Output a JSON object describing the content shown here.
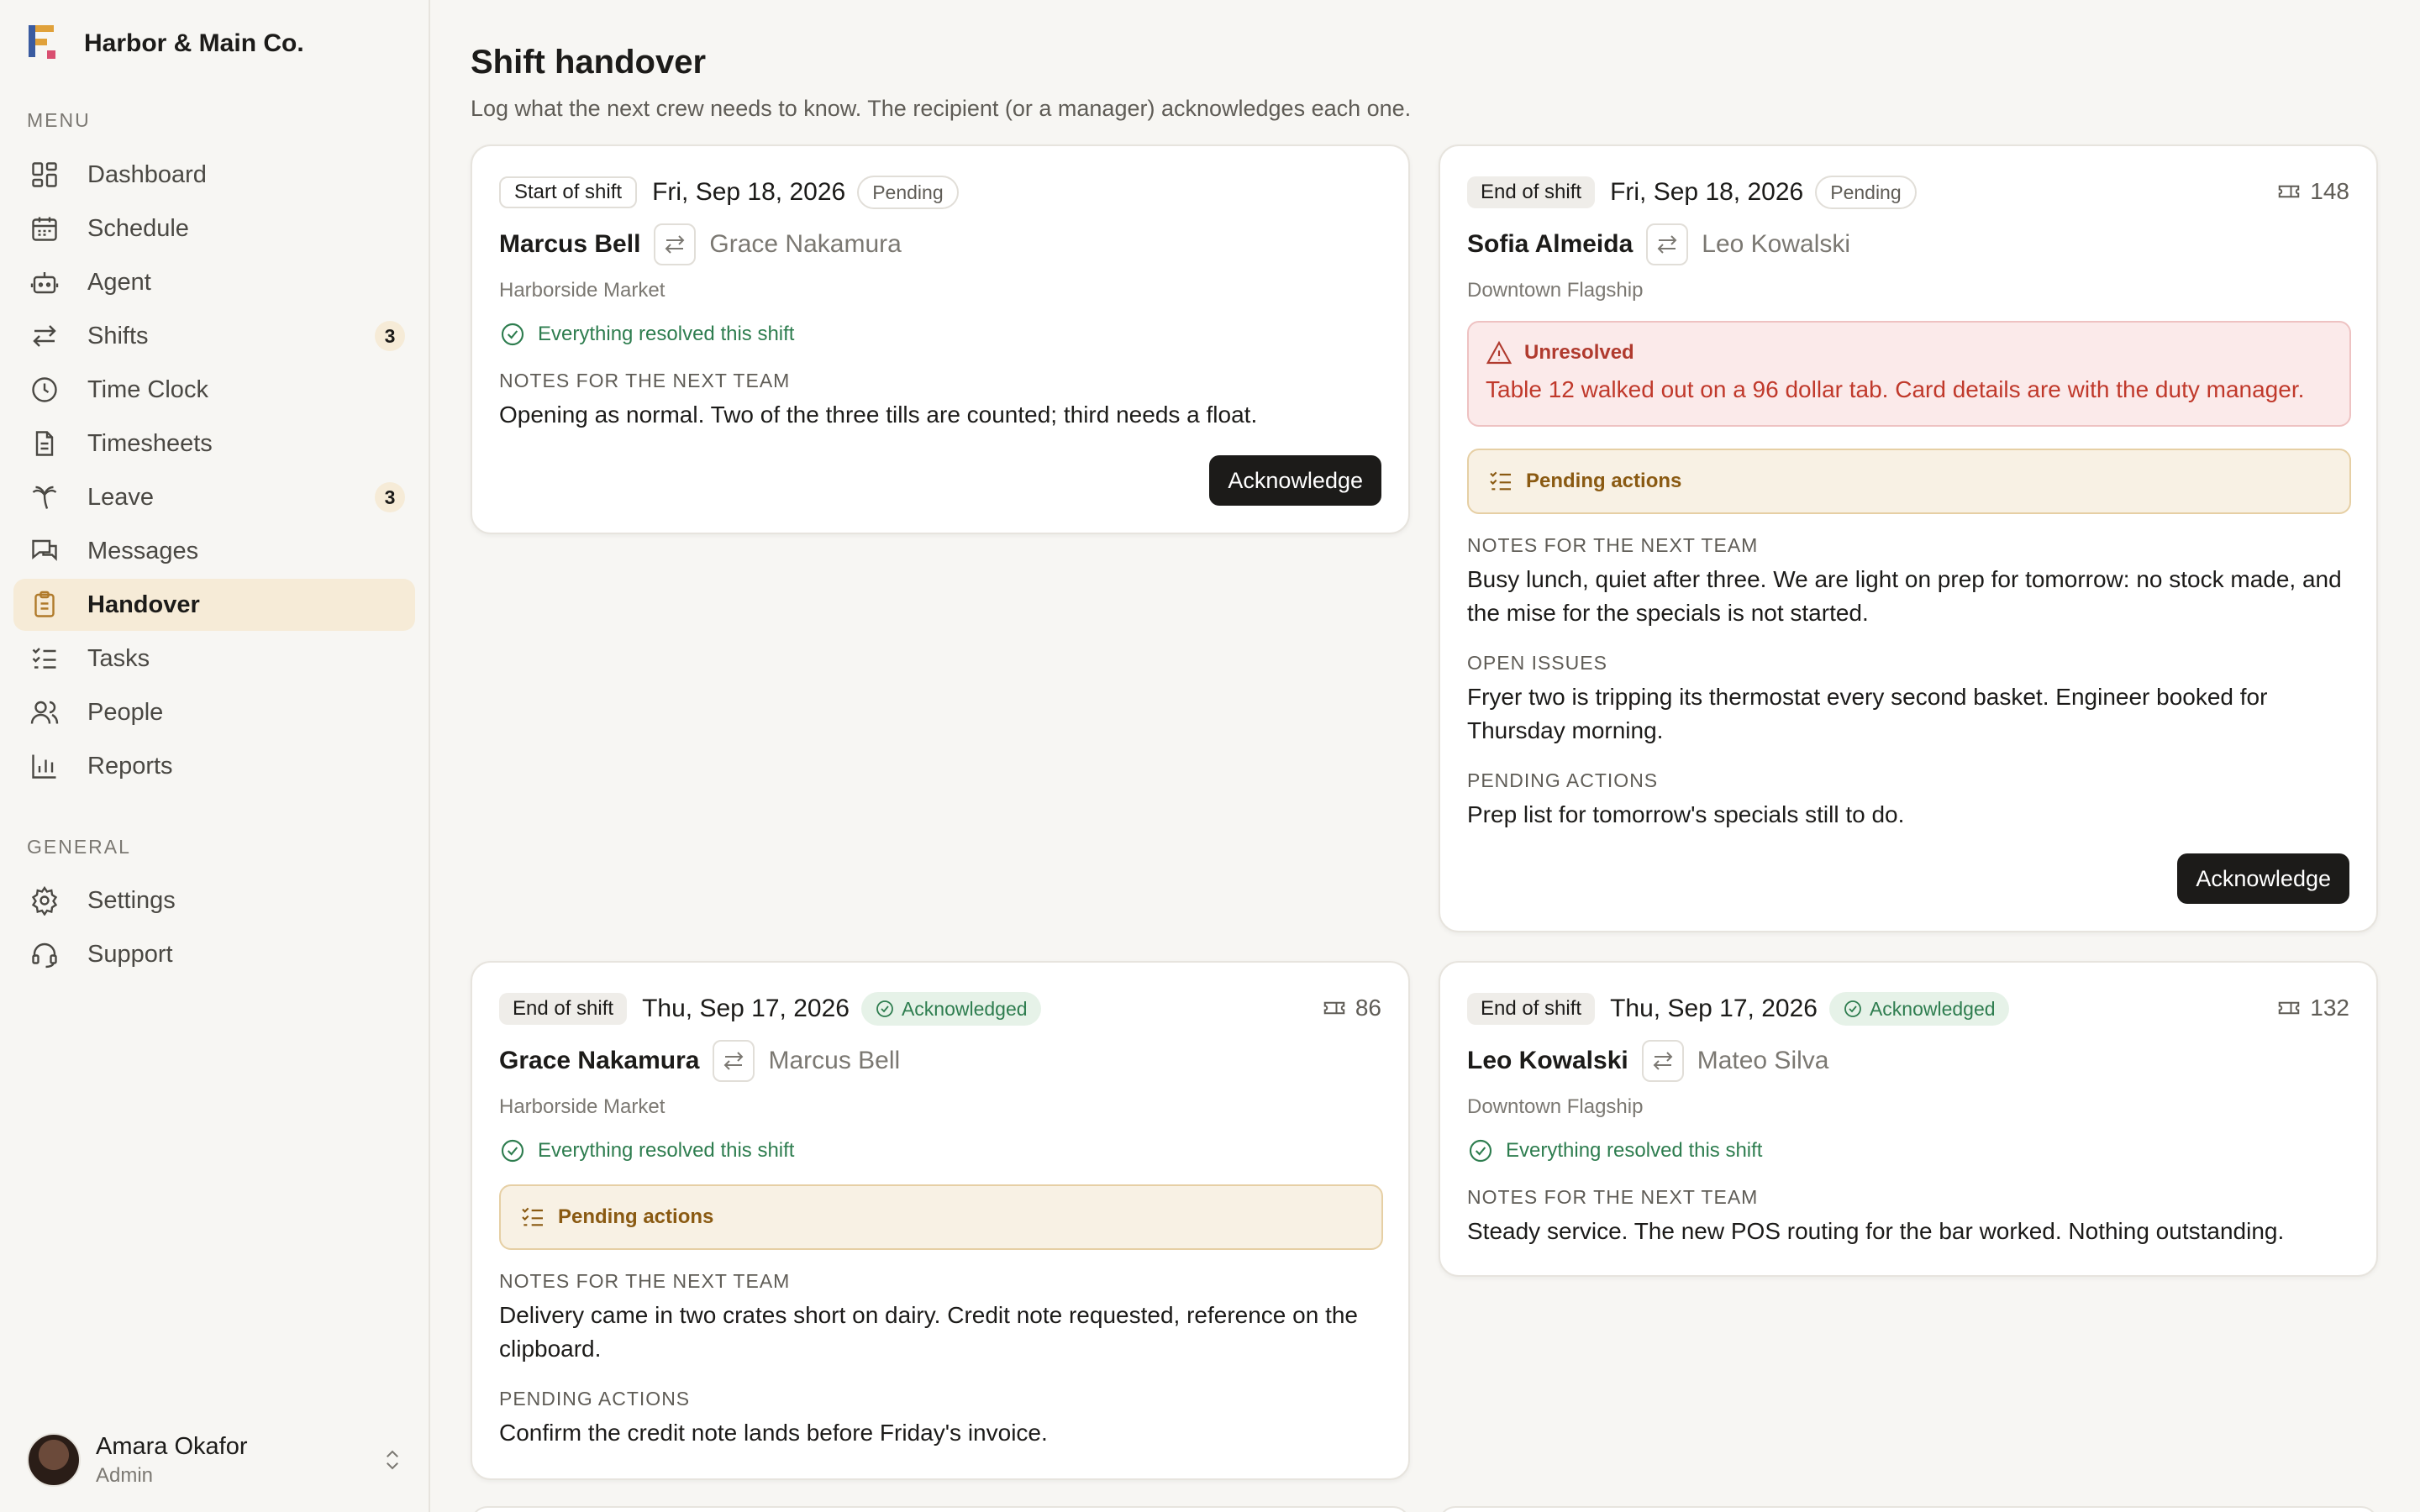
{
  "brand": {
    "name": "Harbor & Main Co."
  },
  "sidebar": {
    "menu_label": "MENU",
    "general_label": "GENERAL",
    "items": [
      {
        "label": "Dashboard",
        "icon": "dashboard-icon"
      },
      {
        "label": "Schedule",
        "icon": "calendar-icon"
      },
      {
        "label": "Agent",
        "icon": "bot-icon"
      },
      {
        "label": "Shifts",
        "icon": "swap-icon",
        "badge": "3"
      },
      {
        "label": "Time Clock",
        "icon": "clock-icon"
      },
      {
        "label": "Timesheets",
        "icon": "document-icon"
      },
      {
        "label": "Leave",
        "icon": "palm-tree-icon",
        "badge": "3"
      },
      {
        "label": "Messages",
        "icon": "messages-icon"
      },
      {
        "label": "Handover",
        "icon": "clipboard-icon",
        "active": true
      },
      {
        "label": "Tasks",
        "icon": "checklist-icon"
      },
      {
        "label": "People",
        "icon": "users-icon"
      },
      {
        "label": "Reports",
        "icon": "bar-chart-icon"
      }
    ],
    "general_items": [
      {
        "label": "Settings",
        "icon": "gear-icon"
      },
      {
        "label": "Support",
        "icon": "headset-icon"
      }
    ],
    "user": {
      "name": "Amara Okafor",
      "role": "Admin"
    }
  },
  "page": {
    "title": "Shift handover",
    "subtitle": "Log what the next crew needs to know. The recipient (or a manager) acknowledges each one."
  },
  "cards": [
    {
      "type": "Start of shift",
      "date": "Fri, Sep 18, 2026",
      "status": "Pending",
      "from": "Marcus Bell",
      "to": "Grace Nakamura",
      "location": "Harborside Market",
      "resolved_text": "Everything resolved this shift",
      "notes_label": "NOTES FOR THE NEXT TEAM",
      "notes": "Opening as normal. Two of the three tills are counted; third needs a float.",
      "button": "Acknowledge"
    },
    {
      "type": "End of shift",
      "date": "Fri, Sep 18, 2026",
      "status": "Pending",
      "ticket": "148",
      "from": "Sofia Almeida",
      "to": "Leo Kowalski",
      "location": "Downtown Flagship",
      "unresolved_title": "Unresolved",
      "unresolved_text": "Table 12 walked out on a 96 dollar tab. Card details are with the duty manager.",
      "pending_box": "Pending actions",
      "notes_label": "NOTES FOR THE NEXT TEAM",
      "notes": "Busy lunch, quiet after three. We are light on prep for tomorrow: no stock made, and the mise for the specials is not started.",
      "issues_label": "OPEN ISSUES",
      "issues": "Fryer two is tripping its thermostat every second basket. Engineer booked for Thursday morning.",
      "actions_label": "PENDING ACTIONS",
      "actions": "Prep list for tomorrow's specials still to do.",
      "button": "Acknowledge"
    },
    {
      "type": "End of shift",
      "date": "Thu, Sep 17, 2026",
      "status": "Acknowledged",
      "ticket": "86",
      "from": "Grace Nakamura",
      "to": "Marcus Bell",
      "location": "Harborside Market",
      "resolved_text": "Everything resolved this shift",
      "pending_box": "Pending actions",
      "notes_label": "NOTES FOR THE NEXT TEAM",
      "notes": "Delivery came in two crates short on dairy. Credit note requested, reference on the clipboard.",
      "actions_label": "PENDING ACTIONS",
      "actions": "Confirm the credit note lands before Friday's invoice."
    },
    {
      "type": "End of shift",
      "date": "Thu, Sep 17, 2026",
      "status": "Acknowledged",
      "ticket": "132",
      "from": "Leo Kowalski",
      "to": "Mateo Silva",
      "location": "Downtown Flagship",
      "resolved_text": "Everything resolved this shift",
      "notes_label": "NOTES FOR THE NEXT TEAM",
      "notes": "Steady service. The new POS routing for the bar worked. Nothing outstanding."
    }
  ],
  "colors": {
    "accent": "#f6ebd7",
    "success": "#2e7d4f",
    "danger": "#c0392b",
    "warning": "#8a5a12",
    "button": "#1c1b19"
  }
}
